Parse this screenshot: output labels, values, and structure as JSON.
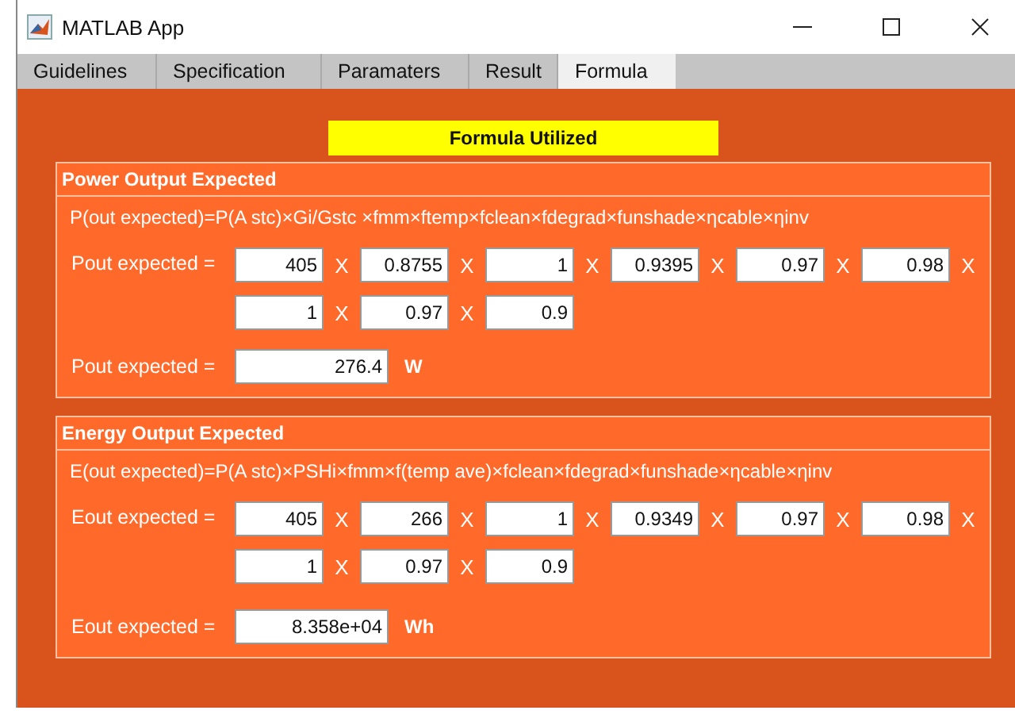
{
  "window": {
    "title": "MATLAB App"
  },
  "tabs": [
    {
      "label": "Guidelines",
      "selected": false
    },
    {
      "label": "Specification",
      "selected": false
    },
    {
      "label": "Paramaters",
      "selected": false
    },
    {
      "label": "Result",
      "selected": false
    },
    {
      "label": "Formula",
      "selected": true
    }
  ],
  "banner": "Formula Utilized",
  "panels": [
    {
      "title": "Power Output Expected",
      "formula": "P(out expected)=P(A stc)×Gi/Gstc ×fmm×ftemp×fclean×fdegrad×funshade×ηcable×ηinv",
      "label": "Pout expected =",
      "rows": [
        [
          {
            "value": "405",
            "sep": "X"
          },
          {
            "value": "0.8755",
            "sep": "X"
          },
          {
            "value": "1",
            "sep": "X"
          },
          {
            "value": "0.9395",
            "sep": "X"
          },
          {
            "value": "0.97",
            "sep": "X"
          },
          {
            "value": "0.98",
            "sep": "X"
          }
        ],
        [
          {
            "value": "1",
            "sep": "X"
          },
          {
            "value": "0.97",
            "sep": "X"
          },
          {
            "value": "0.9"
          }
        ]
      ],
      "result_label": "Pout expected =",
      "result": "276.4",
      "unit": "W"
    },
    {
      "title": "Energy Output Expected",
      "formula": "E(out expected)=P(A stc)×PSHi×fmm×f(temp ave)×fclean×fdegrad×funshade×ηcable×ηinv",
      "label": "Eout expected =",
      "rows": [
        [
          {
            "value": "405",
            "sep": "X"
          },
          {
            "value": "266",
            "sep": "X"
          },
          {
            "value": "1",
            "sep": "X"
          },
          {
            "value": "0.9349",
            "sep": "X"
          },
          {
            "value": "0.97",
            "sep": "X"
          },
          {
            "value": "0.98",
            "sep": "X"
          }
        ],
        [
          {
            "value": "1",
            "sep": "X"
          },
          {
            "value": "0.97",
            "sep": "X"
          },
          {
            "value": "0.9"
          }
        ]
      ],
      "result_label": "Eout expected =",
      "result": "8.358e+04",
      "unit": "Wh"
    }
  ]
}
